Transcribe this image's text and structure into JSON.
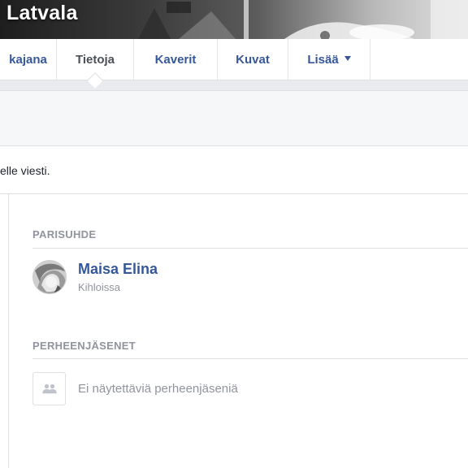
{
  "header": {
    "profile_name": "Latvala"
  },
  "tabs": [
    {
      "label": "kajana",
      "active": false
    },
    {
      "label": "Tietoja",
      "active": true
    },
    {
      "label": "Kaverit",
      "active": false
    },
    {
      "label": "Kuvat",
      "active": false
    },
    {
      "label": "Lisää",
      "active": false,
      "has_caret": true
    }
  ],
  "notice": {
    "text": "elle viesti."
  },
  "relationship": {
    "section_title": "PARISUHDE",
    "partner_name": "Maisa Elina",
    "status": "Kihloissa"
  },
  "family": {
    "section_title": "PERHEENJÄSENET",
    "empty_text": "Ei näytettäviä perheenjäseniä",
    "icon": "people-icon"
  },
  "colors": {
    "link_blue": "#365899",
    "muted_grey": "#90949c",
    "border": "#dddfe2",
    "page_bg": "#e9ebee"
  }
}
